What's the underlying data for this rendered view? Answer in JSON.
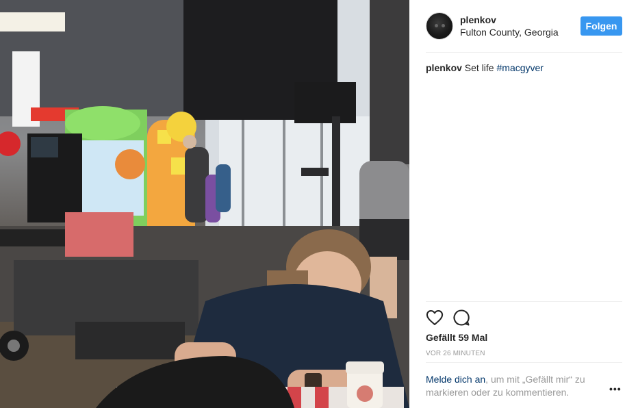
{
  "post": {
    "username": "plenkov",
    "location": "Fulton County, Georgia",
    "follow_label": "Folgen",
    "caption": {
      "username": "plenkov",
      "text": " Set life ",
      "hashtag": "#macgyver"
    },
    "likes": "Gefällt 59 Mal",
    "timestamp": "VOR 26 MINUTEN",
    "login_prompt": {
      "link": "Melde dich an",
      "rest": ", um mit „Gefällt mir“ zu markieren oder zu kommentieren."
    },
    "more_label": "•••"
  },
  "icons": {
    "like": "heart-outline-icon",
    "comment": "comment-bubble-icon",
    "more": "more-options-icon"
  },
  "colors": {
    "follow_button": "#3897f0",
    "link": "#003569",
    "secondary_text": "#999999",
    "divider": "#efefef"
  }
}
